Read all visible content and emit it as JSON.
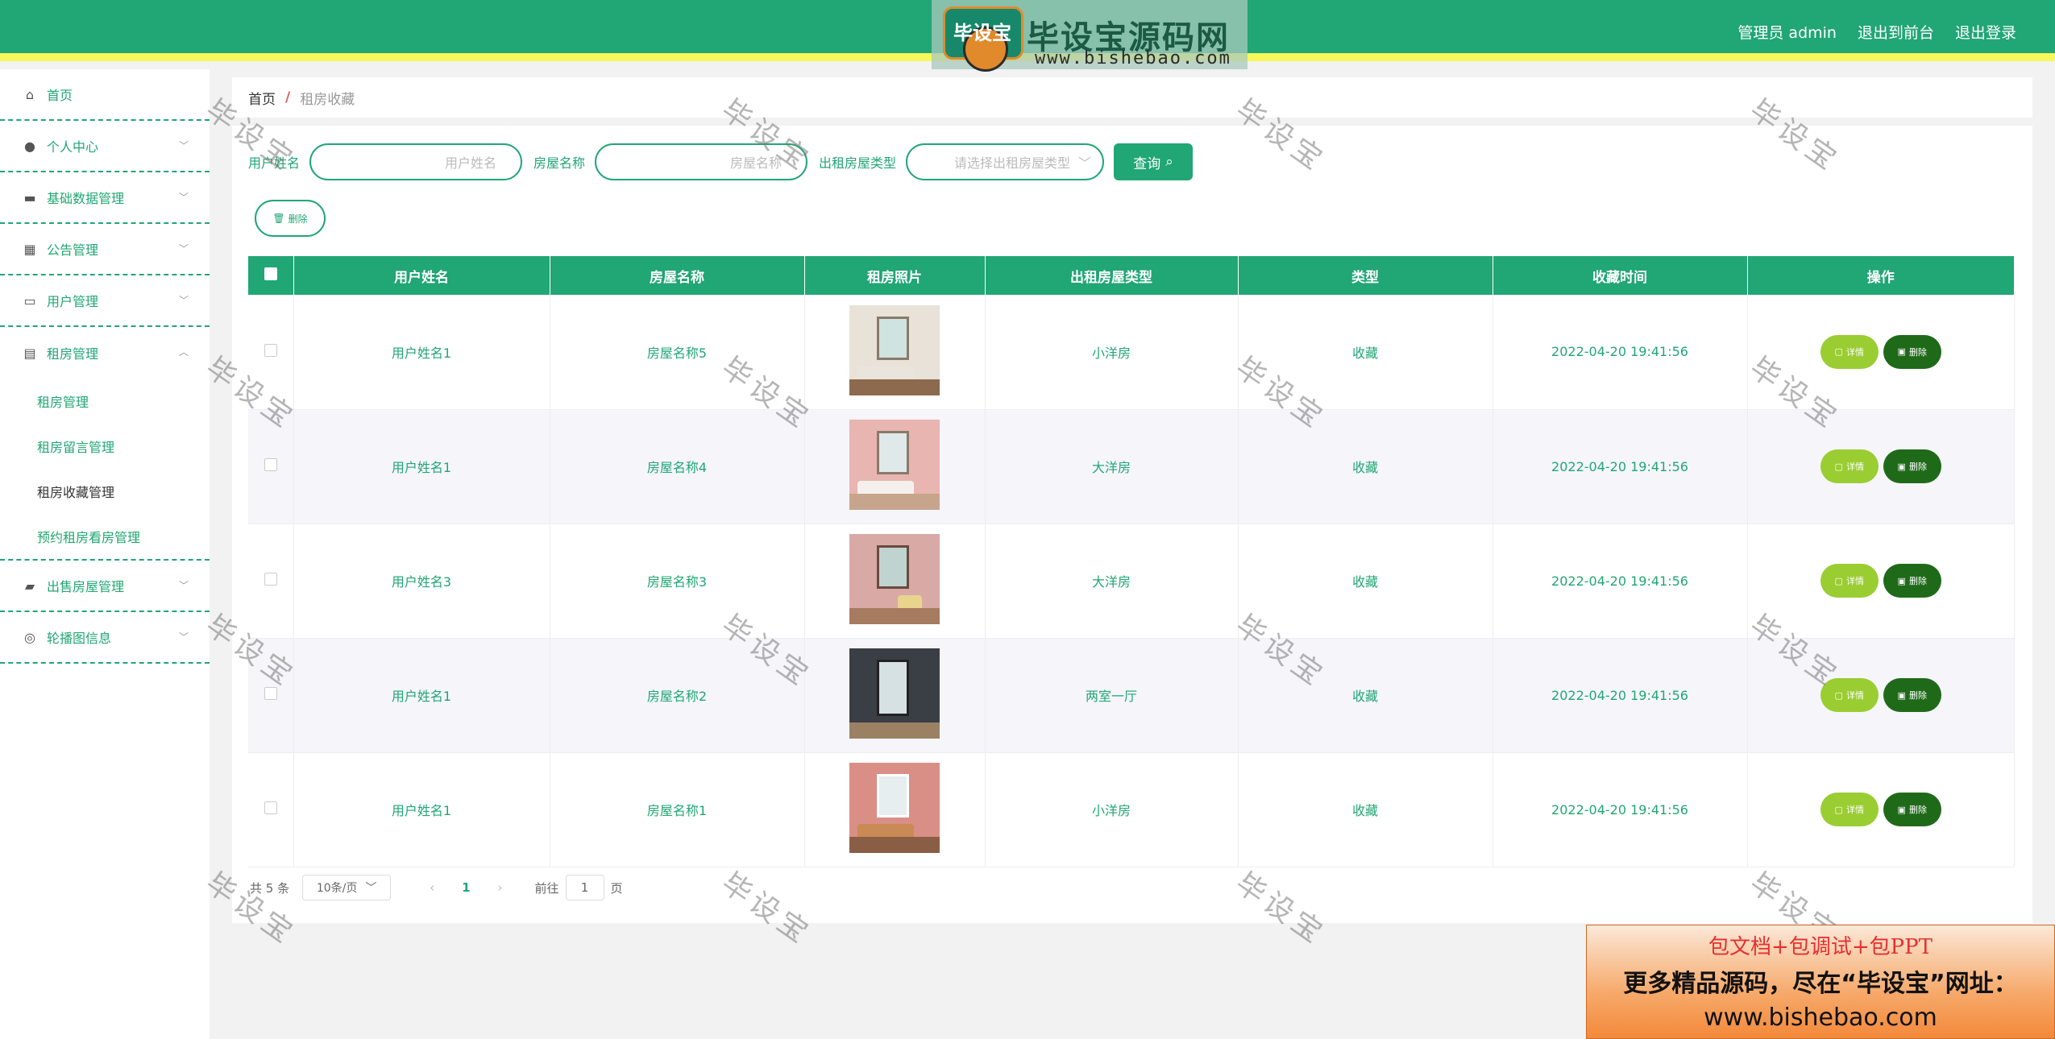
{
  "header": {
    "logo_badge_text": "毕设宝",
    "logo_title": "毕设宝源码网",
    "logo_url": "www.bishebao.com",
    "admin_label": "管理员 admin",
    "front_link": "退出到前台",
    "logout_link": "退出登录"
  },
  "sidebar": {
    "items": [
      {
        "label": "首页",
        "icon": "home-icon"
      },
      {
        "label": "个人中心",
        "icon": "user-icon"
      },
      {
        "label": "基础数据管理",
        "icon": "monitor-icon"
      },
      {
        "label": "公告管理",
        "icon": "grid-icon"
      },
      {
        "label": "用户管理",
        "icon": "id-card-icon"
      },
      {
        "label": "租房管理",
        "icon": "clipboard-icon"
      },
      {
        "label": "出售房屋管理",
        "icon": "ticket-icon"
      },
      {
        "label": "轮播图信息",
        "icon": "aperture-icon"
      }
    ],
    "submenu": [
      {
        "label": "租房管理"
      },
      {
        "label": "租房留言管理"
      },
      {
        "label": "租房收藏管理"
      },
      {
        "label": "预约租房看房管理"
      }
    ]
  },
  "breadcrumb": {
    "home": "首页",
    "sep": "/",
    "current": "租房收藏"
  },
  "filters": {
    "user_label": "用户姓名",
    "user_placeholder": "用户姓名",
    "house_label": "房屋名称",
    "house_placeholder": "房屋名称",
    "type_label": "出租房屋类型",
    "type_placeholder": "请选择出租房屋类型",
    "query_button": "查询",
    "delete_button": "删除"
  },
  "table": {
    "columns": [
      "用户姓名",
      "房屋名称",
      "租房照片",
      "出租房屋类型",
      "类型",
      "收藏时间",
      "操作"
    ],
    "detail_label": "详情",
    "delete_label": "删除",
    "rows": [
      {
        "user": "用户姓名1",
        "house": "房屋名称5",
        "type": "小洋房",
        "kind": "收藏",
        "time": "2022-04-20 19:41:56"
      },
      {
        "user": "用户姓名1",
        "house": "房屋名称4",
        "type": "大洋房",
        "kind": "收藏",
        "time": "2022-04-20 19:41:56"
      },
      {
        "user": "用户姓名3",
        "house": "房屋名称3",
        "type": "大洋房",
        "kind": "收藏",
        "time": "2022-04-20 19:41:56"
      },
      {
        "user": "用户姓名1",
        "house": "房屋名称2",
        "type": "两室一厅",
        "kind": "收藏",
        "time": "2022-04-20 19:41:56"
      },
      {
        "user": "用户姓名1",
        "house": "房屋名称1",
        "type": "小洋房",
        "kind": "收藏",
        "time": "2022-04-20 19:41:56"
      }
    ]
  },
  "pagination": {
    "total_text": "共 5 条",
    "page_size": "10条/页",
    "current_page": "1",
    "goto_label": "前往",
    "goto_value": "1",
    "page_unit": "页"
  },
  "watermark": "毕设宝",
  "ad": {
    "line1": "包文档+包调试+包PPT",
    "line2": "更多精品源码，尽在“毕设宝”网址：",
    "line3": "www.bishebao.com"
  },
  "colors": {
    "primary": "#21a675",
    "accent_yellow": "#f7f75a",
    "detail_btn": "#9acd32",
    "delete_btn": "#1f6a19"
  }
}
